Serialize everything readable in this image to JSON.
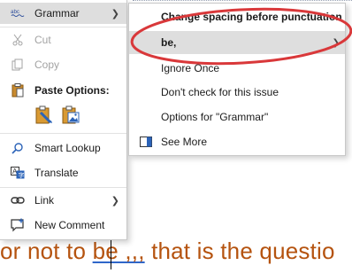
{
  "document": {
    "text_before": "or not to ",
    "underlined_word": "be ,,,",
    "text_after": " that is the questio"
  },
  "context_menu": {
    "items": [
      {
        "label": "Grammar",
        "icon": "abc-proofing-icon",
        "submenu": true,
        "highlighted": true,
        "disabled": false
      },
      {
        "label": "Cut",
        "icon": "scissors-icon",
        "submenu": false,
        "highlighted": false,
        "disabled": true
      },
      {
        "label": "Copy",
        "icon": "copy-icon",
        "submenu": false,
        "highlighted": false,
        "disabled": true
      },
      {
        "label": "Paste Options:",
        "icon": "clipboard-icon",
        "submenu": false,
        "highlighted": false,
        "disabled": false
      },
      {
        "label": "Smart Lookup",
        "icon": "search-icon",
        "submenu": false,
        "highlighted": false,
        "disabled": false
      },
      {
        "label": "Translate",
        "icon": "translate-icon",
        "submenu": false,
        "highlighted": false,
        "disabled": false
      },
      {
        "label": "Link",
        "icon": "link-icon",
        "submenu": true,
        "highlighted": false,
        "disabled": false
      },
      {
        "label": "New Comment",
        "icon": "comment-icon",
        "submenu": false,
        "highlighted": false,
        "disabled": false
      }
    ],
    "icon_text": "abc",
    "paste_buttons": [
      "keep-text-only-icon",
      "picture-icon"
    ]
  },
  "grammar_submenu": {
    "suggestion_header": "Change spacing before punctuation",
    "suggestion": "be,",
    "items": [
      "Ignore Once",
      "Don't check for this issue",
      "Options for \"Grammar\""
    ],
    "see_more": "See More"
  },
  "colors": {
    "document_text": "#b5530f",
    "underline": "#2f66c9",
    "annotation_oval": "#d9383a",
    "highlight": "#dedede"
  }
}
